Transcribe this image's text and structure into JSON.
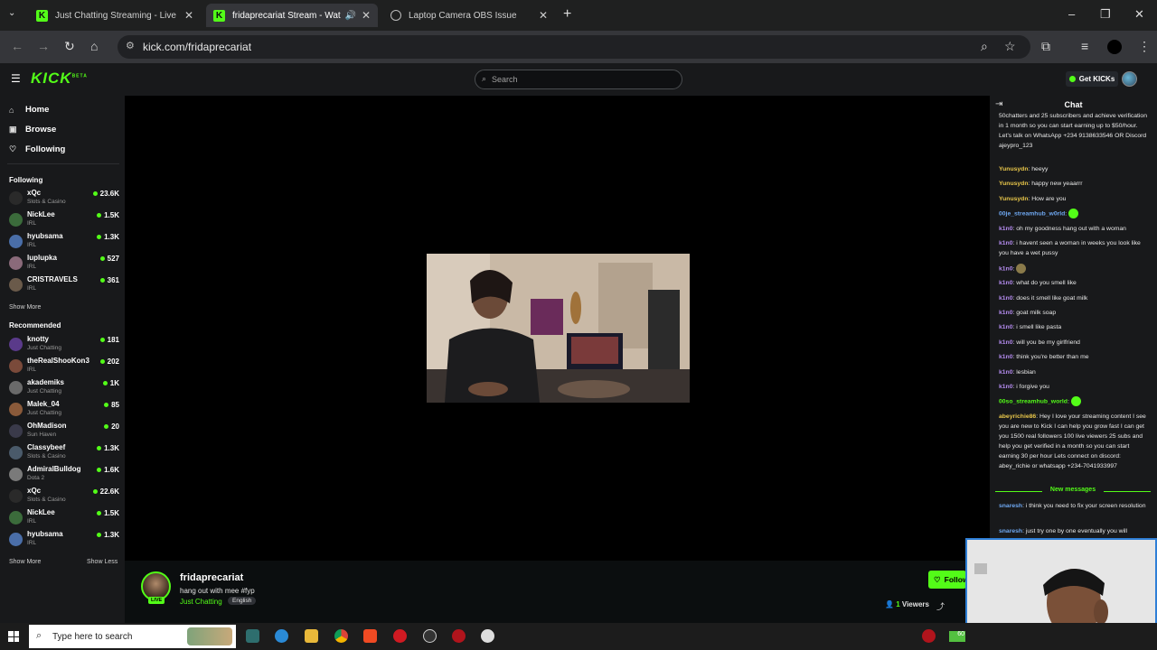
{
  "browser": {
    "tabs": [
      {
        "title": "Just Chatting Streaming - Live Streams"
      },
      {
        "title": "fridaprecariat Stream - Watch Live"
      },
      {
        "title": "Laptop Camera OBS Issue"
      }
    ],
    "url": "kick.com/fridaprecariat"
  },
  "kick": {
    "logo": "KICK",
    "logo_beta": "BETA",
    "search_placeholder": "Search",
    "get_kicks": "Get KICKs",
    "nav": {
      "home": "Home",
      "browse": "Browse",
      "following": "Following"
    },
    "following_header": "Following",
    "recommended_header": "Recommended",
    "show_more": "Show More",
    "show_less": "Show Less",
    "following_channels": [
      {
        "name": "xQc",
        "category": "Slots & Casino",
        "viewers": "23.6K"
      },
      {
        "name": "NickLee",
        "category": "IRL",
        "viewers": "1.5K"
      },
      {
        "name": "hyubsama",
        "category": "IRL",
        "viewers": "1.3K"
      },
      {
        "name": "luplupka",
        "category": "IRL",
        "viewers": "527"
      },
      {
        "name": "CRISTRAVELS",
        "category": "IRL",
        "viewers": "361"
      }
    ],
    "recommended_channels": [
      {
        "name": "knotty",
        "category": "Just Chatting",
        "viewers": "181"
      },
      {
        "name": "theRealShooKon3",
        "category": "IRL",
        "viewers": "202"
      },
      {
        "name": "akademiks",
        "category": "Just Chatting",
        "viewers": "1K"
      },
      {
        "name": "Malek_04",
        "category": "Just Chatting",
        "viewers": "85"
      },
      {
        "name": "OhMadison",
        "category": "Sun Haven",
        "viewers": "20"
      },
      {
        "name": "Classybeef",
        "category": "Slots & Casino",
        "viewers": "1.3K"
      },
      {
        "name": "AdmiralBulldog",
        "category": "Dota 2",
        "viewers": "1.6K"
      },
      {
        "name": "xQc",
        "category": "Slots & Casino",
        "viewers": "22.6K"
      },
      {
        "name": "NickLee",
        "category": "IRL",
        "viewers": "1.5K"
      },
      {
        "name": "hyubsama",
        "category": "IRL",
        "viewers": "1.3K"
      }
    ],
    "stream": {
      "streamer": "fridaprecariat",
      "live_badge": "LIVE",
      "title": "hang out with mee #fyp",
      "category": "Just Chatting",
      "language": "English",
      "viewers_count": "1",
      "viewers_label": "Viewers",
      "follow": "Follow"
    },
    "chat": {
      "title": "Chat",
      "new_messages": "New messages",
      "messages": [
        {
          "user": "",
          "text": "50chatters and 25 subscribers and achieve verification in 1 month so you can start earning up to $50/hour. Let's talk on WhatsApp +234 9138633546 OR Discord ajeypro_123",
          "color": "#e9e9e9"
        },
        {
          "user": "Yunusydn",
          "text": "heeyy",
          "color": "#e8c64a"
        },
        {
          "user": "Yunusydn",
          "text": "happy new yeaarrr",
          "color": "#e8c64a"
        },
        {
          "user": "Yunusydn",
          "text": "How are you",
          "color": "#e8c64a"
        },
        {
          "user": "00je_streamhub_w0rld",
          "text": "",
          "color": "#6ea7f0"
        },
        {
          "user": "k1n0",
          "text": "oh my goodness hang out with a woman",
          "color": "#b58cf0"
        },
        {
          "user": "k1n0",
          "text": "i havent seen a woman in weeks you look like you have a wet pussy",
          "color": "#b58cf0"
        },
        {
          "user": "k1n0",
          "text": "",
          "color": "#b58cf0"
        },
        {
          "user": "k1n0",
          "text": "what do you smell like",
          "color": "#b58cf0"
        },
        {
          "user": "k1n0",
          "text": "does it smell like goat milk",
          "color": "#b58cf0"
        },
        {
          "user": "k1n0",
          "text": "goat milk soap",
          "color": "#b58cf0"
        },
        {
          "user": "k1n0",
          "text": "i smell like pasta",
          "color": "#b58cf0"
        },
        {
          "user": "k1n0",
          "text": "will you be my girlfriend",
          "color": "#b58cf0"
        },
        {
          "user": "k1n0",
          "text": "think you're better than me",
          "color": "#b58cf0"
        },
        {
          "user": "k1n0",
          "text": "lesbian",
          "color": "#b58cf0"
        },
        {
          "user": "k1n0",
          "text": "i forgive you",
          "color": "#b58cf0"
        },
        {
          "user": "00so_streamhub_world",
          "text": "",
          "color": "#53fc18"
        },
        {
          "user": "abeyrichie86",
          "text": "Hey I love your streaming content I see you are new to Kick I can help you grow fast I can get you 1500 real followers 100 live viewers 25 subs and help you get verified in a month so you can start earning 30 per hour Lets connect on discord: abey_richie or whatsapp +234-7041933997",
          "color": "#e8c64a"
        },
        {
          "user": "snaresh",
          "text": "i think you need to fix your screen resolution",
          "color": "#6ea7f0"
        },
        {
          "user": "snaresh",
          "text": "just try one by one eventually you will",
          "color": "#6ea7f0"
        }
      ]
    }
  },
  "taskbar": {
    "search_placeholder": "Type here to search",
    "battery": "60"
  },
  "colors": {
    "kick_green": "#53fc18",
    "bg": "#0b0e0f",
    "panel": "#18191b"
  }
}
